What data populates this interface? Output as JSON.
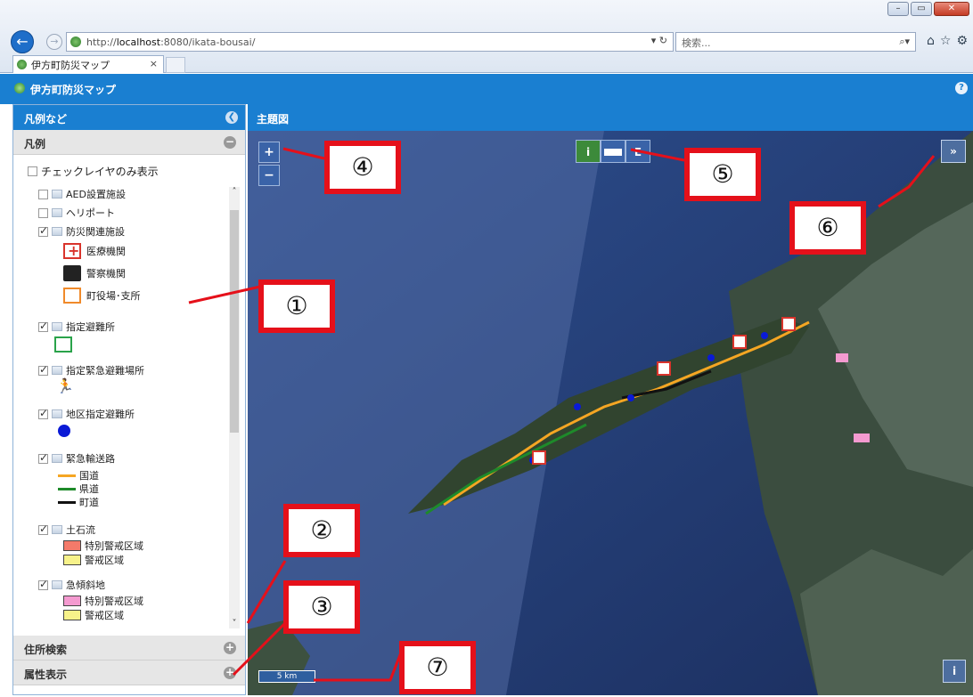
{
  "browser": {
    "url_prefix": "http://",
    "url_host": "localhost",
    "url_rest": ":8080/ikata-bousai/",
    "search_placeholder": "検索...",
    "tab_title": "伊方町防災マップ",
    "tab_close": "×",
    "addr_controls": "▾ ↻"
  },
  "app": {
    "title": "伊方町防災マップ",
    "help_icon": "?"
  },
  "left_panel": {
    "title": "凡例など",
    "legend_header": "凡例",
    "only_checked_label": "チェックレイヤのみ表示",
    "layers": [
      {
        "label": "AED設置施設",
        "checked": false
      },
      {
        "label": "ヘリポート",
        "checked": false
      },
      {
        "label": "防災関連施設",
        "checked": true
      },
      {
        "label": "指定避難所",
        "checked": true
      },
      {
        "label": "指定緊急避難場所",
        "checked": true
      },
      {
        "label": "地区指定避難所",
        "checked": true
      },
      {
        "label": "緊急輸送路",
        "checked": true
      },
      {
        "label": "土石流",
        "checked": true
      },
      {
        "label": "急傾斜地",
        "checked": true
      }
    ],
    "facility_items": [
      "医療機関",
      "警察機関",
      "町役場･支所"
    ],
    "road_items": [
      {
        "label": "国道",
        "color": "#f5a623"
      },
      {
        "label": "県道",
        "color": "#1e8a2a"
      },
      {
        "label": "町道",
        "color": "#111111"
      }
    ],
    "debris_items": [
      {
        "label": "特別警戒区域",
        "color": "#f47a6a"
      },
      {
        "label": "警戒区域",
        "color": "#f7f28a"
      }
    ],
    "slope_items": [
      {
        "label": "特別警戒区域",
        "color": "#f49ad0"
      },
      {
        "label": "警戒区域",
        "color": "#f7f28a"
      }
    ],
    "address_search_header": "住所検索",
    "attribute_header": "属性表示"
  },
  "map_panel": {
    "title": "主題図",
    "zoom_in": "+",
    "zoom_out": "−",
    "info_tool": "i",
    "export_tool": "E",
    "expand": "»",
    "info_button": "i",
    "scale_label": "5 km"
  },
  "callouts": [
    "①",
    "②",
    "③",
    "④",
    "⑤",
    "⑥",
    "⑦"
  ]
}
